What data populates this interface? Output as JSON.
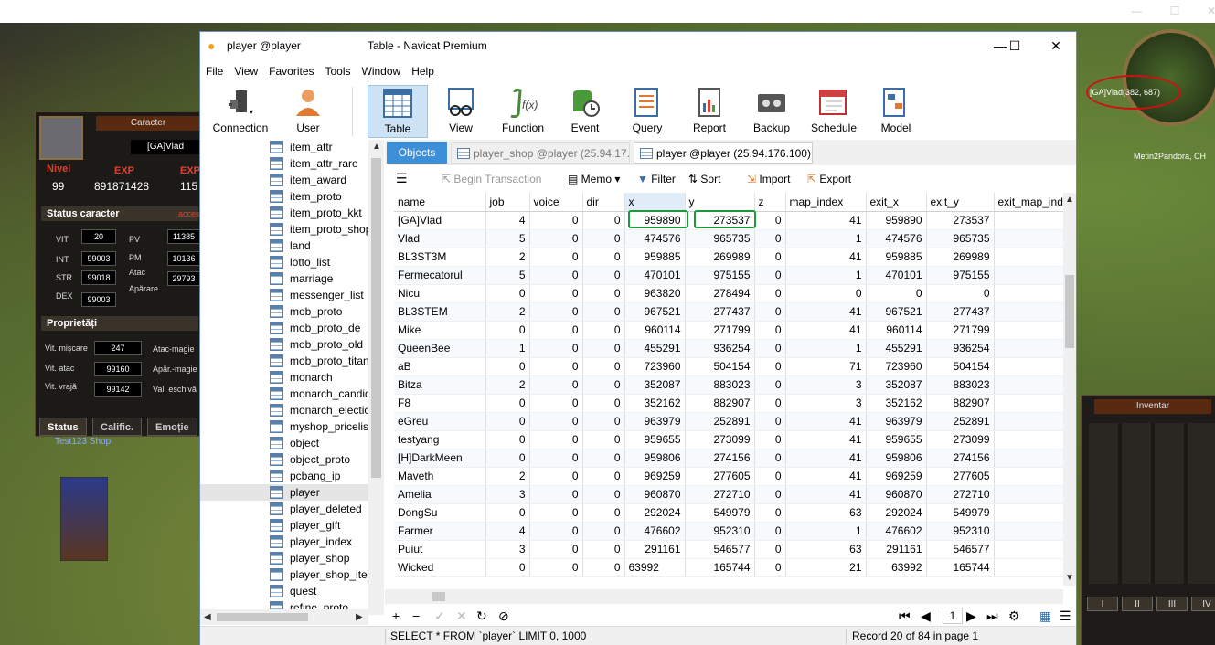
{
  "game": {
    "character_panel": {
      "title": "Caracter",
      "name": "[GA]Vlad",
      "level_label": "Nivel",
      "level": "99",
      "exp_label": "EXP",
      "exp": "891871428",
      "exp2_label": "EXP",
      "exp2": "115",
      "status_label": "Status caracter",
      "status_link": "acces",
      "vit_label": "VIT",
      "vit": "20",
      "int_label": "INT",
      "int": "99003",
      "str_label": "STR",
      "str": "99018",
      "dex_label": "DEX",
      "dex": "99003",
      "pv_label": "PV",
      "pv": "11385",
      "pm_label": "PM",
      "pm": "10136",
      "atac_label": "Atac",
      "atac": "29793",
      "aparare_label": "Apărare",
      "properties_label": "Proprietăți",
      "vit_miscare_label": "Vit. mișcare",
      "vit_miscare": "247",
      "vit_atac_label": "Vit. atac",
      "vit_atac": "99160",
      "vit_vraja_label": "Vit. vrajă",
      "vit_vraja": "99142",
      "atac_magie_label": "Atac-magie",
      "apar_magie_label": "Apăr.-magie",
      "val_eschiva_label": "Val. eschivă",
      "tabs": [
        "Status",
        "Calific.",
        "Emoție"
      ]
    },
    "shop_label": "Test123 Shop",
    "minimap": {
      "coord_text": "[GA]Vlad(382, 687)",
      "location": "Metin2Pandora, CH"
    },
    "inventory": {
      "title": "Inventar",
      "tabs": [
        "I",
        "II",
        "III",
        "IV"
      ]
    }
  },
  "window": {
    "title_left": "player @player",
    "title_right": "Table - Navicat Premium",
    "minimize": "—",
    "maximize": "☐",
    "close": "✕"
  },
  "menu": [
    "File",
    "View",
    "Favorites",
    "Tools",
    "Window",
    "Help"
  ],
  "toolbar": [
    {
      "label": "Connection",
      "icon": "connection-icon"
    },
    {
      "label": "User",
      "icon": "user-icon"
    },
    {
      "label": "Table",
      "icon": "table-icon",
      "active": true
    },
    {
      "label": "View",
      "icon": "view-icon"
    },
    {
      "label": "Function",
      "icon": "function-icon"
    },
    {
      "label": "Event",
      "icon": "event-icon"
    },
    {
      "label": "Query",
      "icon": "query-icon"
    },
    {
      "label": "Report",
      "icon": "report-icon"
    },
    {
      "label": "Backup",
      "icon": "backup-icon"
    },
    {
      "label": "Schedule",
      "icon": "schedule-icon"
    },
    {
      "label": "Model",
      "icon": "model-icon"
    }
  ],
  "tree": {
    "items": [
      "item_attr",
      "item_attr_rare",
      "item_award",
      "item_proto",
      "item_proto_kkt",
      "item_proto_shop",
      "land",
      "lotto_list",
      "marriage",
      "messenger_list",
      "mob_proto",
      "mob_proto_de",
      "mob_proto_old",
      "mob_proto_titan",
      "monarch",
      "monarch_candid",
      "monarch_electic",
      "myshop_pricelis",
      "object",
      "object_proto",
      "pcbang_ip",
      "player",
      "player_deleted",
      "player_gift",
      "player_index",
      "player_shop",
      "player_shop_iter",
      "quest",
      "refine_proto"
    ],
    "selected": "player"
  },
  "tabs": {
    "objects": "Objects",
    "shop": "player_shop @player (25.94.17...",
    "player": "player @player (25.94.176.100) ..."
  },
  "grid_toolbar": {
    "begin_transaction": "Begin Transaction",
    "memo": "Memo",
    "filter": "Filter",
    "sort": "Sort",
    "import": "Import",
    "export": "Export"
  },
  "grid": {
    "columns": [
      "name",
      "job",
      "voice",
      "dir",
      "x",
      "y",
      "z",
      "map_index",
      "exit_x",
      "exit_y",
      "exit_map_ind"
    ],
    "rows": [
      [
        "[GA]Vlad",
        "4",
        "0",
        "0",
        "959890",
        "273537",
        "0",
        "41",
        "959890",
        "273537",
        ""
      ],
      [
        "Vlad",
        "5",
        "0",
        "0",
        "474576",
        "965735",
        "0",
        "1",
        "474576",
        "965735",
        ""
      ],
      [
        "BL3ST3M",
        "2",
        "0",
        "0",
        "959885",
        "269989",
        "0",
        "41",
        "959885",
        "269989",
        ""
      ],
      [
        "Fermecatorul",
        "5",
        "0",
        "0",
        "470101",
        "975155",
        "0",
        "1",
        "470101",
        "975155",
        ""
      ],
      [
        "Nicu",
        "0",
        "0",
        "0",
        "963820",
        "278494",
        "0",
        "0",
        "0",
        "0",
        ""
      ],
      [
        "BL3STEM",
        "2",
        "0",
        "0",
        "967521",
        "277437",
        "0",
        "41",
        "967521",
        "277437",
        ""
      ],
      [
        "Mike",
        "0",
        "0",
        "0",
        "960114",
        "271799",
        "0",
        "41",
        "960114",
        "271799",
        ""
      ],
      [
        "QueenBee",
        "1",
        "0",
        "0",
        "455291",
        "936254",
        "0",
        "1",
        "455291",
        "936254",
        ""
      ],
      [
        "aB",
        "0",
        "0",
        "0",
        "723960",
        "504154",
        "0",
        "71",
        "723960",
        "504154",
        ""
      ],
      [
        "Bitza",
        "2",
        "0",
        "0",
        "352087",
        "883023",
        "0",
        "3",
        "352087",
        "883023",
        ""
      ],
      [
        "F8",
        "0",
        "0",
        "0",
        "352162",
        "882907",
        "0",
        "3",
        "352162",
        "882907",
        ""
      ],
      [
        "eGreu",
        "0",
        "0",
        "0",
        "963979",
        "252891",
        "0",
        "41",
        "963979",
        "252891",
        ""
      ],
      [
        "testyang",
        "0",
        "0",
        "0",
        "959655",
        "273099",
        "0",
        "41",
        "959655",
        "273099",
        ""
      ],
      [
        "[H]DarkMeen",
        "0",
        "0",
        "0",
        "959806",
        "274156",
        "0",
        "41",
        "959806",
        "274156",
        ""
      ],
      [
        "Maveth",
        "2",
        "0",
        "0",
        "969259",
        "277605",
        "0",
        "41",
        "969259",
        "277605",
        ""
      ],
      [
        "Amelia",
        "3",
        "0",
        "0",
        "960870",
        "272710",
        "0",
        "41",
        "960870",
        "272710",
        ""
      ],
      [
        "DongSu",
        "0",
        "0",
        "0",
        "292024",
        "549979",
        "0",
        "63",
        "292024",
        "549979",
        ""
      ],
      [
        "Farmer",
        "4",
        "0",
        "0",
        "476602",
        "952310",
        "0",
        "1",
        "476602",
        "952310",
        ""
      ],
      [
        "Puiut",
        "3",
        "0",
        "0",
        "291161",
        "546577",
        "0",
        "63",
        "291161",
        "546577",
        ""
      ],
      [
        "Wicked",
        "0",
        "0",
        "0",
        "63992",
        "165744",
        "0",
        "21",
        "63992",
        "165744",
        ""
      ]
    ],
    "editing_row_index": 19
  },
  "navbar": {
    "page": "1"
  },
  "status": {
    "sql": "SELECT * FROM `player` LIMIT 0, 1000",
    "record": "Record 20 of 84 in page 1"
  }
}
